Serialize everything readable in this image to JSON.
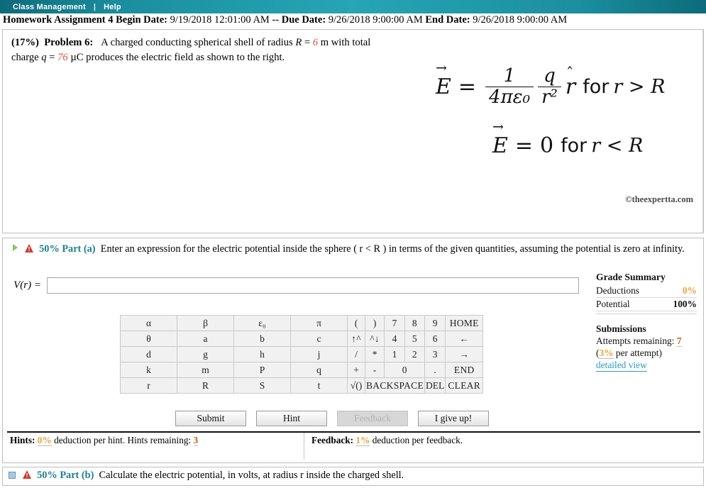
{
  "navbar": {
    "items": [
      {
        "label": "Class Management"
      },
      {
        "label": "Help"
      }
    ],
    "separator": "|",
    "background_color": "#27a5b4"
  },
  "assignment": {
    "title": "Homework Assignment 4",
    "begin_label": "Begin Date:",
    "begin_value": "9/19/2018 12:01:00 AM",
    "dash": "--",
    "due_label": "Due Date:",
    "due_value": "9/26/2018 9:00:00 AM",
    "end_label": "End Date:",
    "end_value": "9/26/2018 9:00:00 AM"
  },
  "problem": {
    "percent": "(17%)",
    "label": "Problem 6:",
    "text_part1": "A charged conducting spherical shell of radius",
    "var_R": "R",
    "eq1": "=",
    "value_R": "6",
    "unit_R": "m with total",
    "text_part2": "charge",
    "var_q": "q",
    "eq2": "=",
    "value_q": "76",
    "unit_q": "µC produces the electric field as shown to the right.",
    "equation_1": {
      "lhs": "E",
      "equals": "=",
      "frac1_num": "1",
      "frac1_den": "4πε₀",
      "frac2_num": "q",
      "frac2_den": "r²",
      "unit_vector": "r",
      "condition": "for",
      "condition_expr": "r > R"
    },
    "equation_2": {
      "lhs": "E",
      "equals": "=",
      "rhs": "0",
      "condition": "for",
      "condition_expr": "r < R"
    },
    "copyright": "©theexpertta.com"
  },
  "part_a": {
    "weight": "50%",
    "name": "Part (a)",
    "prompt_line1": "Enter an expression for the electric potential inside the sphere ( r < R ) in terms of the given quantities, assuming the potential is",
    "prompt_line2": "zero at infinity.",
    "answer_label": "V(r) =",
    "answer_value": "",
    "answer_placeholder": ""
  },
  "keypad": {
    "rows": [
      [
        "α",
        "β",
        "ε₀",
        "π"
      ],
      [
        "θ",
        "a",
        "b",
        "c"
      ],
      [
        "d",
        "g",
        "h",
        "j"
      ],
      [
        "k",
        "m",
        "P",
        "q"
      ],
      [
        "r",
        "R",
        "S",
        "t"
      ]
    ],
    "ops": {
      "r1": [
        "(",
        ")",
        "7",
        "8",
        "9",
        "HOME"
      ],
      "r2": [
        "↑^",
        "^↓",
        "4",
        "5",
        "6",
        "←"
      ],
      "r3": [
        "/",
        "*",
        "1",
        "2",
        "3",
        "→"
      ],
      "r4": [
        "+",
        "-",
        "0",
        ".",
        "END"
      ],
      "r5": [
        "√()",
        "BACKSPACE",
        "DEL",
        "CLEAR"
      ]
    }
  },
  "grade_summary": {
    "title": "Grade Summary",
    "rows": [
      {
        "label": "Deductions",
        "value": "0%",
        "style": "orange"
      },
      {
        "label": "Potential",
        "value": "100%",
        "style": "bold"
      }
    ],
    "submissions_title": "Submissions",
    "attempts_label": "Attempts remaining:",
    "attempts_value": "7",
    "per_attempt_open": "(",
    "per_attempt_value": "3%",
    "per_attempt_text": "per attempt)",
    "detailed_view": "detailed view"
  },
  "buttons": {
    "submit": "Submit",
    "hint": "Hint",
    "feedback": "Feedback",
    "give_up": "I give up!"
  },
  "hints_bar": {
    "hints_label": "Hints:",
    "hints_deduction": "0%",
    "hints_text": "deduction per hint. Hints remaining:",
    "hints_remaining": "3",
    "feedback_label": "Feedback:",
    "feedback_deduction": "1%",
    "feedback_text": "deduction per feedback."
  },
  "part_b": {
    "weight": "50%",
    "name": "Part (b)",
    "prompt": "Calculate the electric potential, in volts, at radius r inside the charged shell."
  }
}
